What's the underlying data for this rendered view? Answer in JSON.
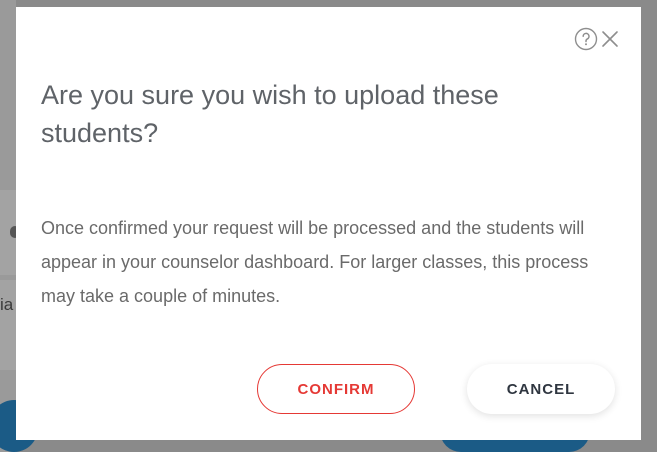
{
  "background": {
    "edge_text": "ia"
  },
  "dialog": {
    "title": "Are you sure you wish to upload these students?",
    "body": "Once confirmed your request will be processed and the students will appear in your counselor dashboard. For larger classes, this process may take a couple of minutes.",
    "confirm_label": "CONFIRM",
    "cancel_label": "CANCEL",
    "help_icon": "question-circle-icon",
    "close_icon": "close-x-icon"
  },
  "colors": {
    "accent_red": "#e53935",
    "title_gray": "#5f6368",
    "body_gray": "#6a6a6a",
    "background_blue": "#1b5b86"
  }
}
